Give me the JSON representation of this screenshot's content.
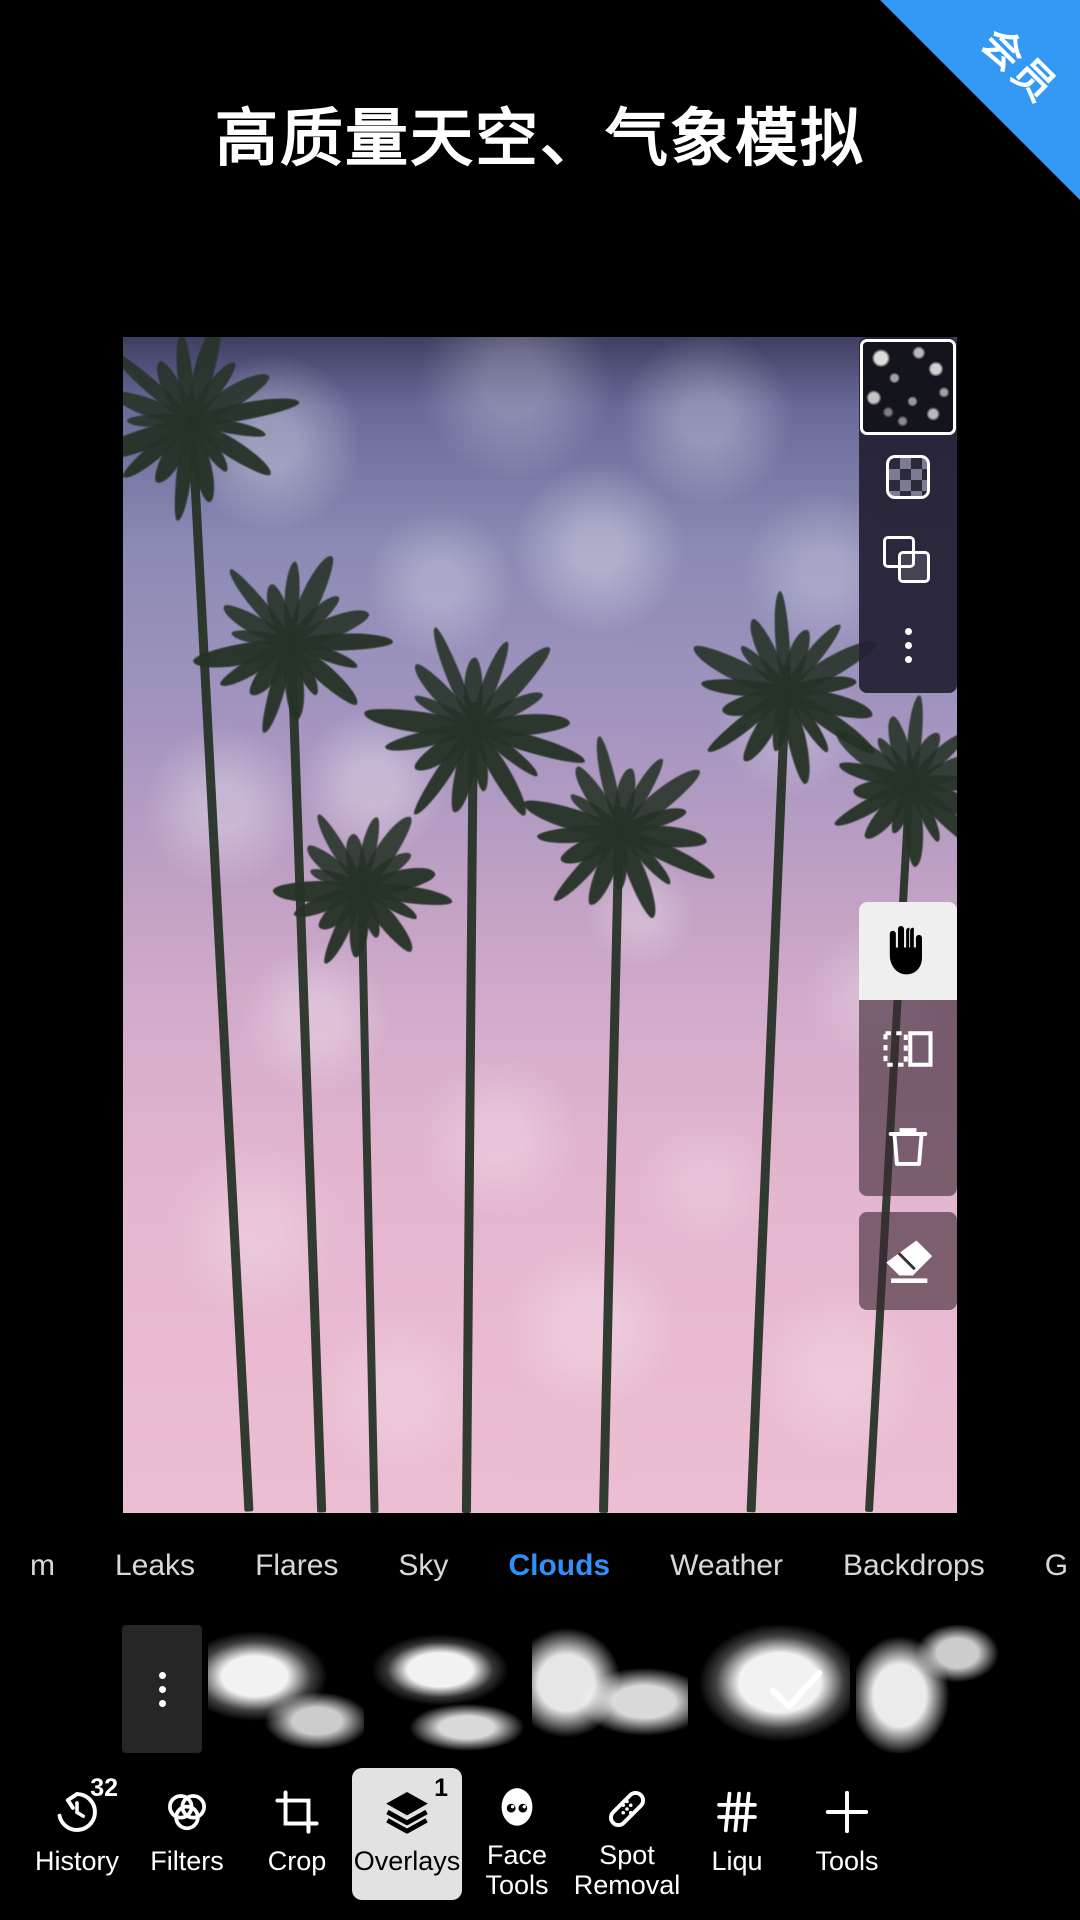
{
  "ribbon": {
    "label": "会员",
    "color": "#3399F5"
  },
  "headline": {
    "text": "高质量天空、气象模拟"
  },
  "accent_color": "#2f90f7",
  "canvas": {
    "photo_description": "palm-trees-sunset-sky",
    "sky_top_color": "#8b8bb5",
    "sky_bottom_color": "#ecbed3"
  },
  "layer_panel": {
    "thumbnail_name": "snow-overlay-thumbnail",
    "buttons": [
      {
        "name": "opacity-checker-button",
        "icon": "checkerboard-icon"
      },
      {
        "name": "blend-mode-button",
        "icon": "overlapping-squares-icon"
      },
      {
        "name": "more-options-button",
        "icon": "kebab-menu-icon"
      }
    ]
  },
  "tool_panel": {
    "buttons": [
      {
        "name": "pan-hand-tool",
        "icon": "hand-icon",
        "selected": true
      },
      {
        "name": "flip-mirror-tool",
        "icon": "mirror-flip-icon",
        "selected": false
      },
      {
        "name": "delete-layer-tool",
        "icon": "trash-icon",
        "selected": false
      }
    ],
    "eraser": {
      "name": "eraser-tool",
      "icon": "eraser-icon"
    }
  },
  "tabs": [
    {
      "label": "m",
      "active": false,
      "cut": true
    },
    {
      "label": "Leaks",
      "active": false
    },
    {
      "label": "Flares",
      "active": false
    },
    {
      "label": "Sky",
      "active": false
    },
    {
      "label": "Clouds",
      "active": true
    },
    {
      "label": "Weather",
      "active": false
    },
    {
      "label": "Backdrops",
      "active": false
    },
    {
      "label": "G",
      "active": false,
      "cut": true
    }
  ],
  "overlay_thumbnails": [
    {
      "name": "more-overlays-button",
      "icon": "kebab-menu-icon",
      "type": "more"
    },
    {
      "name": "cloud-overlay-1",
      "type": "cloud"
    },
    {
      "name": "cloud-overlay-2",
      "type": "cloud"
    },
    {
      "name": "cloud-overlay-3",
      "type": "cloud"
    },
    {
      "name": "cloud-overlay-4",
      "type": "cloud"
    },
    {
      "name": "cloud-overlay-5",
      "type": "cloud"
    }
  ],
  "confirm": {
    "name": "confirm-button",
    "icon": "checkmark-icon"
  },
  "bottom_toolbar": [
    {
      "label": "History",
      "icon": "history-undo-icon",
      "badge": "32",
      "selected": false
    },
    {
      "label": "Filters",
      "icon": "filters-circles-icon",
      "badge": "",
      "selected": false
    },
    {
      "label": "Crop",
      "icon": "crop-icon",
      "badge": "",
      "selected": false
    },
    {
      "label": "Overlays",
      "icon": "layers-icon",
      "badge": "1",
      "selected": true
    },
    {
      "label": "Face\nTools",
      "icon": "face-icon",
      "badge": "",
      "selected": false
    },
    {
      "label": "Spot\nRemoval",
      "icon": "bandage-icon",
      "badge": "",
      "selected": false
    },
    {
      "label": "Liqu",
      "icon": "liquify-icon",
      "badge": "",
      "selected": false
    },
    {
      "label": "Tools",
      "icon": "plus-icon",
      "badge": "",
      "selected": false
    }
  ]
}
